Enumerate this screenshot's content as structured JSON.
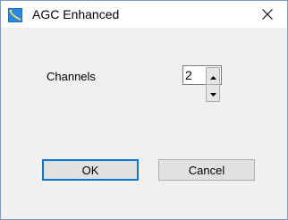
{
  "window": {
    "title": "AGC Enhanced",
    "app_icon": "app-window-icon",
    "close_icon": "close-icon"
  },
  "form": {
    "channels_label": "Channels",
    "channels_value": "2"
  },
  "buttons": {
    "ok_label": "OK",
    "cancel_label": "Cancel"
  },
  "colors": {
    "accent": "#0078d7",
    "window_border": "#7a9cc4",
    "client_bg": "#f0f0f0"
  }
}
